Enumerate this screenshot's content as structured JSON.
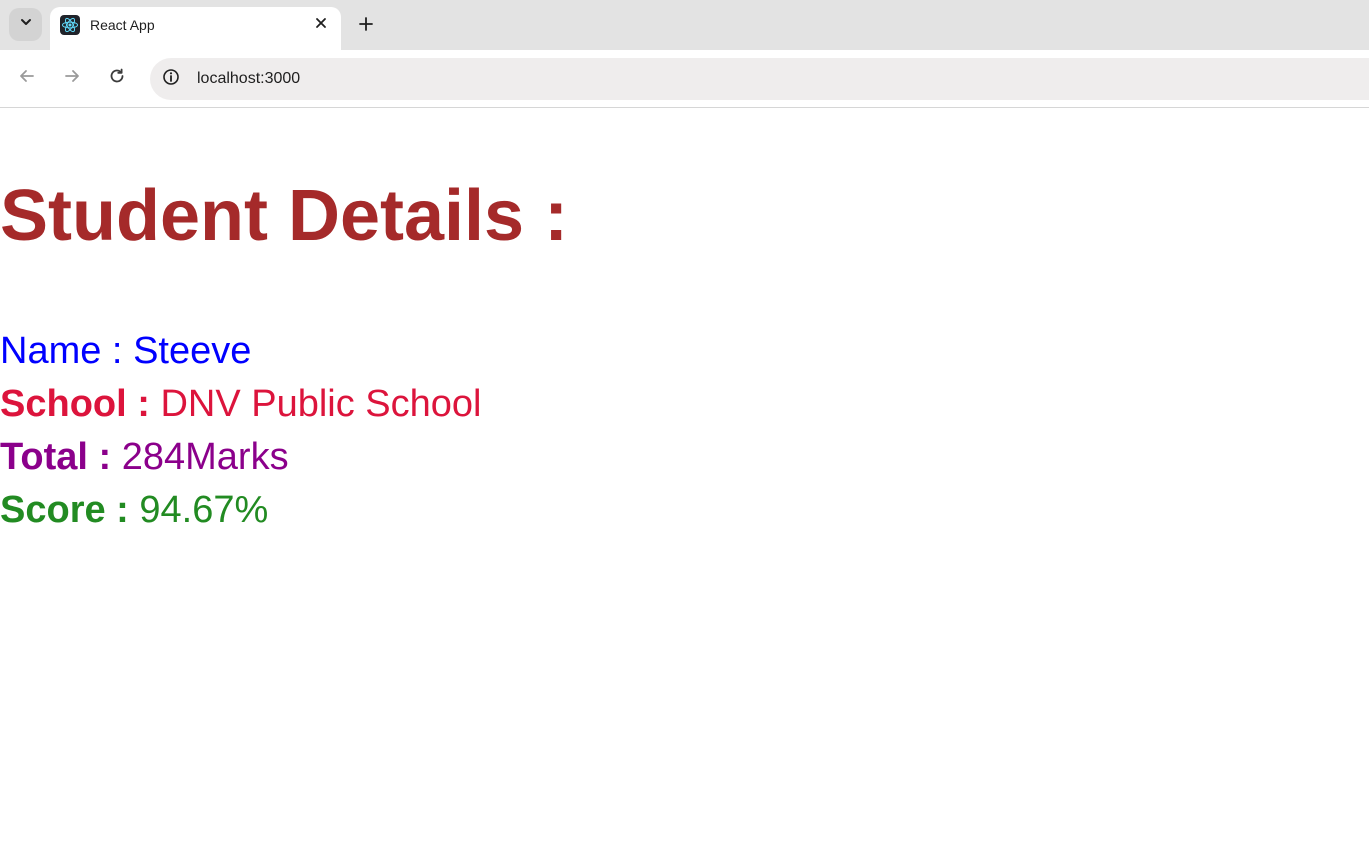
{
  "browser": {
    "tab": {
      "title": "React App"
    },
    "address_bar": {
      "url": "localhost:3000"
    },
    "icons": {
      "tab_list": "chevron-down-icon",
      "favicon": "react-logo-icon",
      "close": "close-icon",
      "new_tab": "plus-icon",
      "back": "arrow-left-icon",
      "forward": "arrow-right-icon",
      "reload": "reload-icon",
      "site_info": "info-icon"
    }
  },
  "page": {
    "heading": "Student Details :",
    "details": {
      "name_label": "Name",
      "name_sep": " : ",
      "name_value": "Steeve",
      "school_label": "School :",
      "school_value": " DNV Public School",
      "total_label": "Total :",
      "total_value": " 284Marks",
      "score_label": "Score :",
      "score_value": " 94.67%"
    },
    "colors": {
      "heading": "#a52a2a",
      "name": "#0000ff",
      "school": "#dc143c",
      "total": "#8b008b",
      "score": "#228b22"
    }
  }
}
